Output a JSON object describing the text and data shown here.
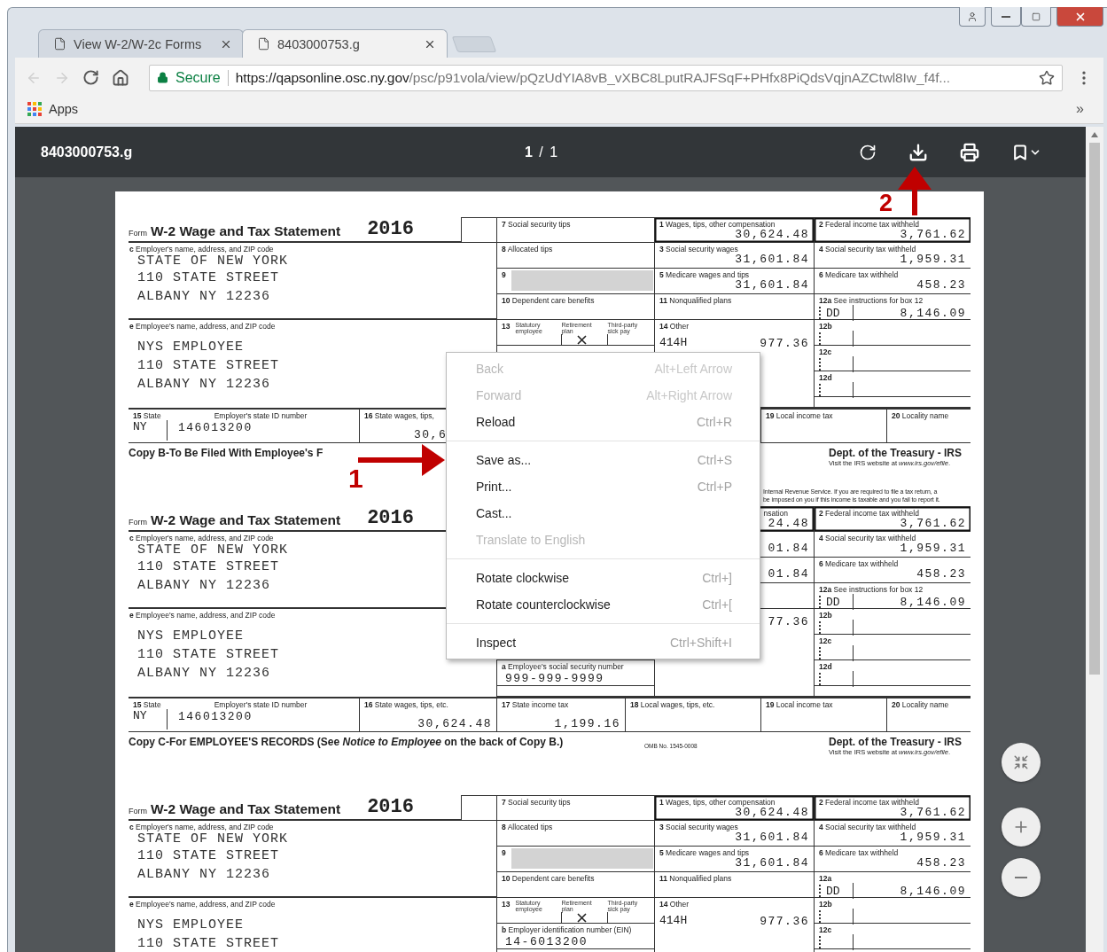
{
  "tabs": [
    {
      "title": "View W-2/W-2c Forms",
      "selected": false
    },
    {
      "title": "8403000753.g",
      "selected": true
    }
  ],
  "address_bar": {
    "security": "Secure",
    "url_host": "https://qapsonline.osc.ny.gov",
    "url_path": "/psc/p91vola/view/pQzUdYIA8vB_vXBC8LputRAJFSqF+PHfx8PiQdsVqjnAZCtwl8Iw_f4f..."
  },
  "bookmarks_bar": {
    "items": [
      "Apps"
    ],
    "overflow": "»"
  },
  "pdf_viewer": {
    "title": "8403000753.g",
    "page_indicator": "**1** / 1"
  },
  "form_copies": [
    {
      "form_label": "Form",
      "title": "W-2 Wage and Tax Statement",
      "year": "2016",
      "employer": {
        "label": "**c** Employer's name, address, and ZIP code",
        "lines": [
          "STATE OF NEW YORK",
          "110 STATE STREET",
          "ALBANY NY 12236"
        ]
      },
      "employee": {
        "label": "**e** Employee's name, address, and ZIP code",
        "lines": [
          "NYS EMPLOYEE",
          "110 STATE STREET",
          "ALBANY NY 12236"
        ]
      },
      "boxes": {
        "box_7": {
          "kind": "amount",
          "label": "**7** Social security tips"
        },
        "box_8": {
          "kind": "amount",
          "label": "**8** Allocated tips"
        },
        "box_9": {
          "kind": "shaded",
          "label": "**9**"
        },
        "box_10": {
          "kind": "amount",
          "label": "**10** Dependent care benefits"
        },
        "box_13": {
          "kind": "checkboxes",
          "label": "**13**",
          "options": [
            {
              "label": "Statutory employee",
              "checked": false
            },
            {
              "label": "Retirement plan",
              "checked": true
            },
            {
              "label": "Third-party sick pay",
              "checked": false
            }
          ]
        },
        "box_1": {
          "kind": "amount",
          "label": "**1** Wages, tips, other compensation",
          "value": "30,624.48"
        },
        "box_3": {
          "kind": "amount",
          "label": "**3** Social security wages",
          "value": "31,601.84"
        },
        "box_5": {
          "kind": "amount",
          "label": "**5** Medicare wages and tips",
          "value": "31,601.84"
        },
        "box_11": {
          "kind": "amount",
          "label": "**11** Nonqualified plans"
        },
        "box_14": {
          "kind": "other",
          "label": "**14** Other",
          "code": "414H",
          "value": "977.36"
        },
        "box_2": {
          "kind": "amount",
          "label": "**2** Federal income tax withheld",
          "value": "3,761.62"
        },
        "box_4": {
          "kind": "amount",
          "label": "**4** Social security tax withheld",
          "value": "1,959.31"
        },
        "box_6": {
          "kind": "amount",
          "label": "**6** Medicare tax withheld",
          "value": "458.23"
        },
        "box_12a": {
          "kind": "code",
          "label": "**12a** See instructions for box 12",
          "code": "DD",
          "value": "8,146.09"
        },
        "box_12b": {
          "kind": "code",
          "label": "**12b**"
        },
        "box_12c": {
          "kind": "code",
          "label": "**12c**"
        },
        "box_12d": {
          "kind": "code",
          "label": "**12d**"
        }
      },
      "state_row": {
        "box_15": {
          "kind": "state",
          "label": "**15** State",
          "sublabel": "Employer's state ID number",
          "state": "NY",
          "id": "146013200"
        },
        "box_16": {
          "kind": "amount",
          "label": "**16** State wages, tips,",
          "value": "30,6",
          "cut_right": true
        },
        "box_19": {
          "kind": "amount",
          "label": "**19** Local income tax"
        },
        "box_20": {
          "kind": "amount",
          "label": "**20** Locality name"
        }
      },
      "caption": {
        "text": "Copy B-To Be Filed With Employee's F",
        "agency": "Dept. of the Treasury - IRS",
        "website": "Visit the IRS website at *www.irs.gov/efile*."
      }
    },
    {
      "notice": [
        "Internal Revenue Service. If you are required to file a tax return, a",
        "be imposed on you if this income is taxable and you fail to report it."
      ],
      "form_label": "Form",
      "title": "W-2 Wage and Tax Statement",
      "year": "2016",
      "employer": {
        "label": "**c** Employer's name, address, and ZIP code",
        "lines": [
          "STATE OF NEW YORK",
          "110 STATE STREET",
          "ALBANY NY 12236"
        ]
      },
      "employee": {
        "label": "**e** Employee's name, address, and ZIP code",
        "lines": [
          "NYS EMPLOYEE",
          "110 STATE STREET",
          "ALBANY NY 12236"
        ]
      },
      "boxes": {
        "box_a": {
          "kind": "id",
          "label": "**a** Employee's social security number",
          "value": "999-999-9999"
        },
        "box_1": {
          "kind": "amount",
          "label": "nsation",
          "value": "24.48",
          "cut_left": true
        },
        "box_3": {
          "kind": "amount",
          "value": "01.84"
        },
        "box_5": {
          "kind": "amount",
          "value": "01.84"
        },
        "box_14": {
          "kind": "other",
          "value": "77.36"
        },
        "box_2": {
          "kind": "amount",
          "label": "**2** Federal income tax withheld",
          "value": "3,761.62"
        },
        "box_4": {
          "kind": "amount",
          "label": "**4** Social security tax withheld",
          "value": "1,959.31"
        },
        "box_6": {
          "kind": "amount",
          "label": "**6** Medicare tax withheld",
          "value": "458.23"
        },
        "box_12a": {
          "kind": "code",
          "label": "**12a** See instructions for box 12",
          "code": "DD",
          "value": "8,146.09"
        },
        "box_12b": {
          "kind": "code",
          "label": "**12b**"
        },
        "box_12c": {
          "kind": "code",
          "label": "**12c**"
        },
        "box_12d": {
          "kind": "code",
          "label": "**12d**"
        }
      },
      "state_row": {
        "box_15": {
          "kind": "state",
          "label": "**15** State",
          "sublabel": "Employer's state ID number",
          "state": "NY",
          "id": "146013200"
        },
        "box_16": {
          "kind": "amount",
          "label": "**16** State wages, tips, etc.",
          "value": "30,624.48"
        },
        "box_17": {
          "kind": "amount",
          "label": "**17** State income tax",
          "value": "1,199.16"
        },
        "box_18": {
          "kind": "amount",
          "label": "**18** Local wages, tips, etc."
        },
        "box_19": {
          "kind": "amount",
          "label": "**19** Local income tax"
        },
        "box_20": {
          "kind": "amount",
          "label": "**20** Locality name"
        }
      },
      "caption": {
        "text": "Copy C-For EMPLOYEE'S RECORDS (See *Notice to Employee* on the back of Copy B.)",
        "omb": "OMB No. 1545-0008",
        "agency": "Dept. of the Treasury - IRS",
        "website": "Visit the IRS website at *www.irs.gov/efile*."
      }
    },
    {
      "form_label": "Form",
      "title": "W-2 Wage and Tax Statement",
      "year": "2016",
      "employer": {
        "label": "**c** Employer's name, address, and ZIP code",
        "lines": [
          "STATE OF NEW YORK",
          "110 STATE STREET",
          "ALBANY NY 12236"
        ]
      },
      "employee": {
        "label": "**e** Employee's name, address, and ZIP code",
        "lines": [
          "NYS EMPLOYEE",
          "110 STATE STREET"
        ]
      },
      "boxes": {
        "box_7": {
          "kind": "amount",
          "label": "**7** Social security tips"
        },
        "box_8": {
          "kind": "amount",
          "label": "**8** Allocated tips"
        },
        "box_9": {
          "kind": "shaded",
          "label": "**9**"
        },
        "box_10": {
          "kind": "amount",
          "label": "**10** Dependent care benefits"
        },
        "box_13": {
          "kind": "checkboxes",
          "label": "**13**",
          "options": [
            {
              "label": "Statutory employee",
              "checked": false
            },
            {
              "label": "Retirement plan",
              "checked": true
            },
            {
              "label": "Third-party sick pay",
              "checked": false
            }
          ]
        },
        "box_b": {
          "kind": "id",
          "label": "**b** Employer identification number (EIN)",
          "value": "14-6013200"
        },
        "box_1": {
          "kind": "amount",
          "label": "**1** Wages, tips, other compensation",
          "value": "30,624.48"
        },
        "box_3": {
          "kind": "amount",
          "label": "**3** Social security wages",
          "value": "31,601.84"
        },
        "box_5": {
          "kind": "amount",
          "label": "**5** Medicare wages and tips",
          "value": "31,601.84"
        },
        "box_11": {
          "kind": "amount",
          "label": "**11** Nonqualified plans"
        },
        "box_14": {
          "kind": "other",
          "label": "**14** Other",
          "code": "414H",
          "value": "977.36"
        },
        "box_2": {
          "kind": "amount",
          "label": "**2** Federal income tax withheld",
          "value": "3,761.62"
        },
        "box_4": {
          "kind": "amount",
          "label": "**4** Social security tax withheld",
          "value": "1,959.31"
        },
        "box_6": {
          "kind": "amount",
          "label": "**6** Medicare tax withheld",
          "value": "458.23"
        },
        "box_12a": {
          "kind": "code",
          "label": "**12a**",
          "code": "DD",
          "value": "8,146.09"
        },
        "box_12b": {
          "kind": "code",
          "label": "**12b**"
        },
        "box_12c": {
          "kind": "code",
          "label": "**12c**"
        }
      }
    }
  ],
  "context_menu": {
    "items": [
      {
        "kind": "item",
        "label": "Back",
        "shortcut": "Alt+Left Arrow",
        "disabled": true
      },
      {
        "kind": "item",
        "label": "Forward",
        "shortcut": "Alt+Right Arrow",
        "disabled": true
      },
      {
        "kind": "item",
        "label": "Reload",
        "shortcut": "Ctrl+R",
        "disabled": false
      },
      {
        "kind": "separator"
      },
      {
        "kind": "item",
        "label": "Save as...",
        "shortcut": "Ctrl+S",
        "disabled": false
      },
      {
        "kind": "item",
        "label": "Print...",
        "shortcut": "Ctrl+P",
        "disabled": false
      },
      {
        "kind": "item",
        "label": "Cast...",
        "disabled": false
      },
      {
        "kind": "item",
        "label": "Translate to English",
        "disabled": true
      },
      {
        "kind": "separator"
      },
      {
        "kind": "item",
        "label": "Rotate clockwise",
        "shortcut": "Ctrl+]",
        "disabled": false
      },
      {
        "kind": "item",
        "label": "Rotate counterclockwise",
        "shortcut": "Ctrl+[",
        "disabled": false
      },
      {
        "kind": "separator"
      },
      {
        "kind": "item",
        "label": "Inspect",
        "shortcut": "Ctrl+Shift+I",
        "disabled": false
      }
    ]
  },
  "annotations": [
    {
      "kind": "right_arrow",
      "label": "1"
    },
    {
      "kind": "up_arrow",
      "label": "2"
    }
  ]
}
